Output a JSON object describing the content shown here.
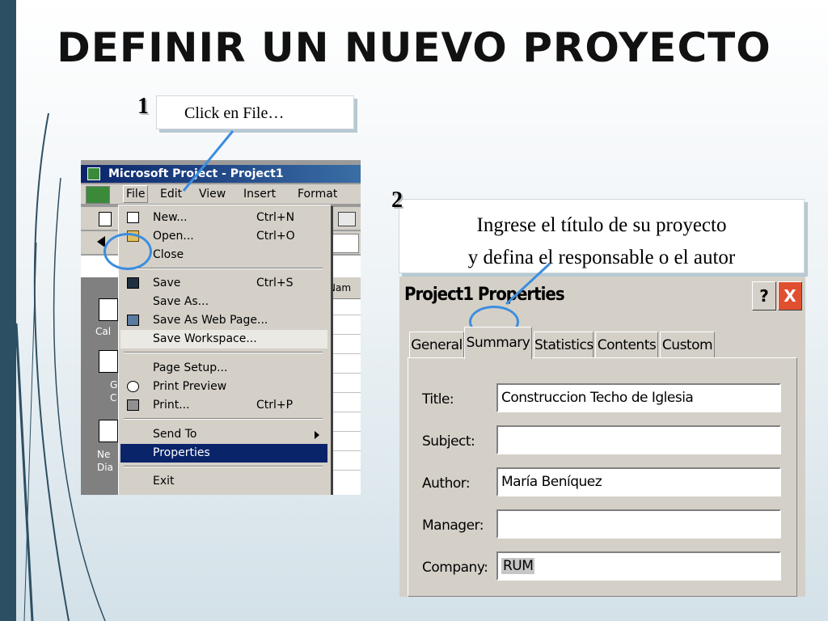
{
  "slide": {
    "title": "DEFINIR UN NUEVO PROYECTO",
    "step1": {
      "number": "1",
      "text": "Click en File…"
    },
    "step2": {
      "number": "2",
      "line1": "Ingrese el título de su proyecto",
      "line2": "y defina el responsable o el autor"
    },
    "colors": {
      "sidebar": "#2d4f63",
      "accent_ring": "#3c8ede"
    }
  },
  "ms_project": {
    "window_title": "Microsoft Project - Project1",
    "menubar": [
      "File",
      "Edit",
      "View",
      "Insert",
      "Format"
    ],
    "file_menu": {
      "items": [
        {
          "label": "New...",
          "shortcut": "Ctrl+N",
          "icon": "new-doc-icon"
        },
        {
          "label": "Open...",
          "shortcut": "Ctrl+O",
          "icon": "open-folder-icon"
        },
        {
          "label": "Close",
          "shortcut": ""
        },
        {
          "label": "Save",
          "shortcut": "Ctrl+S",
          "icon": "floppy-disk-icon"
        },
        {
          "label": "Save As...",
          "shortcut": ""
        },
        {
          "label": "Save As Web Page...",
          "shortcut": "",
          "icon": "web-page-icon"
        },
        {
          "label": "Save Workspace...",
          "shortcut": ""
        },
        {
          "label": "Page Setup...",
          "shortcut": ""
        },
        {
          "label": "Print Preview",
          "shortcut": "",
          "icon": "print-preview-icon"
        },
        {
          "label": "Print...",
          "shortcut": "Ctrl+P",
          "icon": "printer-icon"
        },
        {
          "label": "Send To",
          "shortcut": ""
        },
        {
          "label": "Properties",
          "shortcut": ""
        },
        {
          "label": "Exit",
          "shortcut": ""
        }
      ]
    },
    "left_pane_labels": [
      "Cal",
      "G",
      "C",
      "Ne",
      "Dia"
    ],
    "grid_header": "Nam"
  },
  "properties_dialog": {
    "title": "Project1 Properties",
    "help_button": "?",
    "close_button": "X",
    "tabs": [
      "General",
      "Summary",
      "Statistics",
      "Contents",
      "Custom"
    ],
    "active_tab": "Summary",
    "fields": [
      {
        "label": "Title:",
        "value": "Construccion Techo de Iglesia"
      },
      {
        "label": "Subject:",
        "value": ""
      },
      {
        "label": "Author:",
        "value": "María Beníquez"
      },
      {
        "label": "Manager:",
        "value": ""
      },
      {
        "label": "Company:",
        "value": "RUM"
      }
    ]
  }
}
